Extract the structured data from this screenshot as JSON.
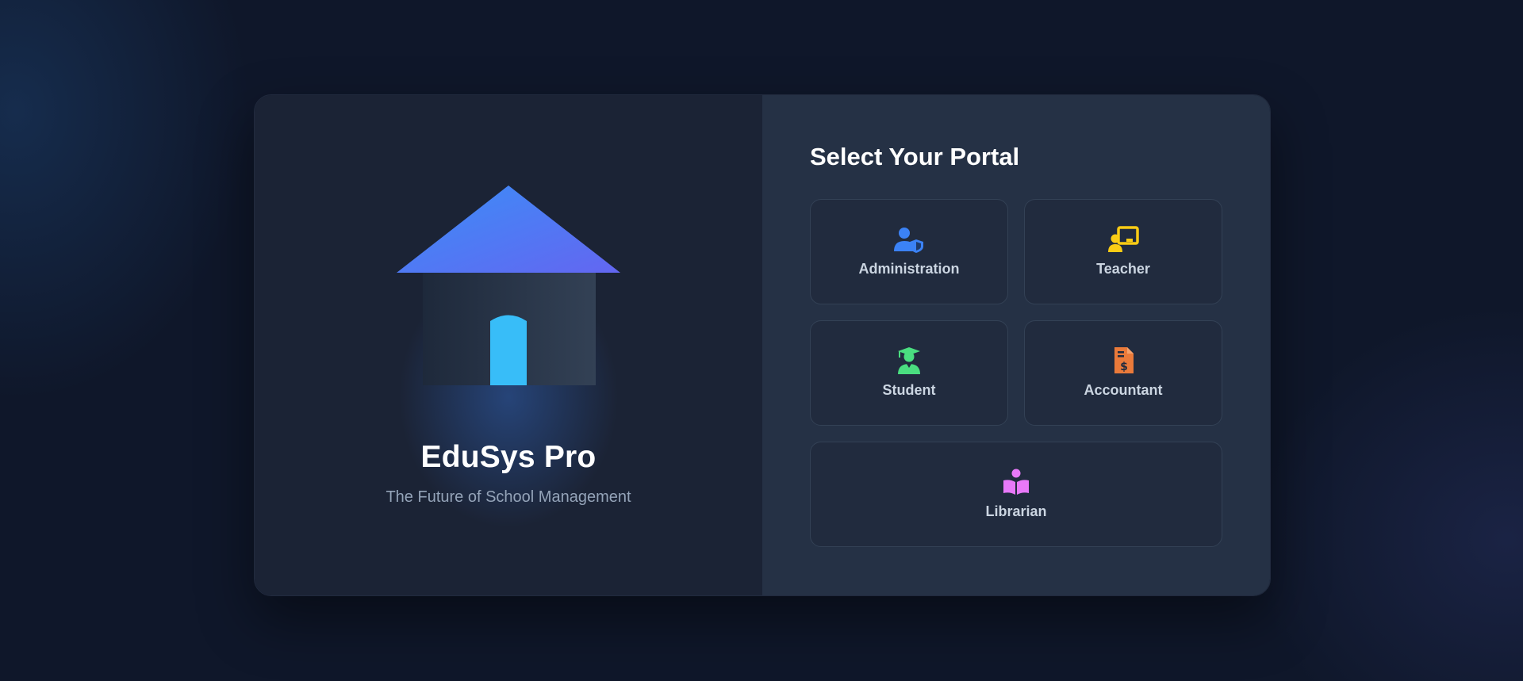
{
  "brand": {
    "title": "EduSys Pro",
    "subtitle": "The Future of School Management",
    "logo_icon": "school-house-icon"
  },
  "portal": {
    "heading": "Select Your Portal",
    "options": [
      {
        "label": "Administration",
        "icon": "user-shield-icon",
        "color": "#3b82f6"
      },
      {
        "label": "Teacher",
        "icon": "chalkboard-teacher-icon",
        "color": "#facc15"
      },
      {
        "label": "Student",
        "icon": "user-graduate-icon",
        "color": "#4ade80"
      },
      {
        "label": "Accountant",
        "icon": "file-invoice-dollar-icon",
        "color": "#ea7a3a"
      },
      {
        "label": "Librarian",
        "icon": "book-reader-icon",
        "color": "#e879f9"
      }
    ]
  },
  "colors": {
    "background": "#0f172a",
    "left_panel": "#1b2335",
    "right_panel": "#253145",
    "roof_gradient_start": "#3b82f6",
    "roof_gradient_end": "#6366f1",
    "door": "#38bdf8"
  }
}
